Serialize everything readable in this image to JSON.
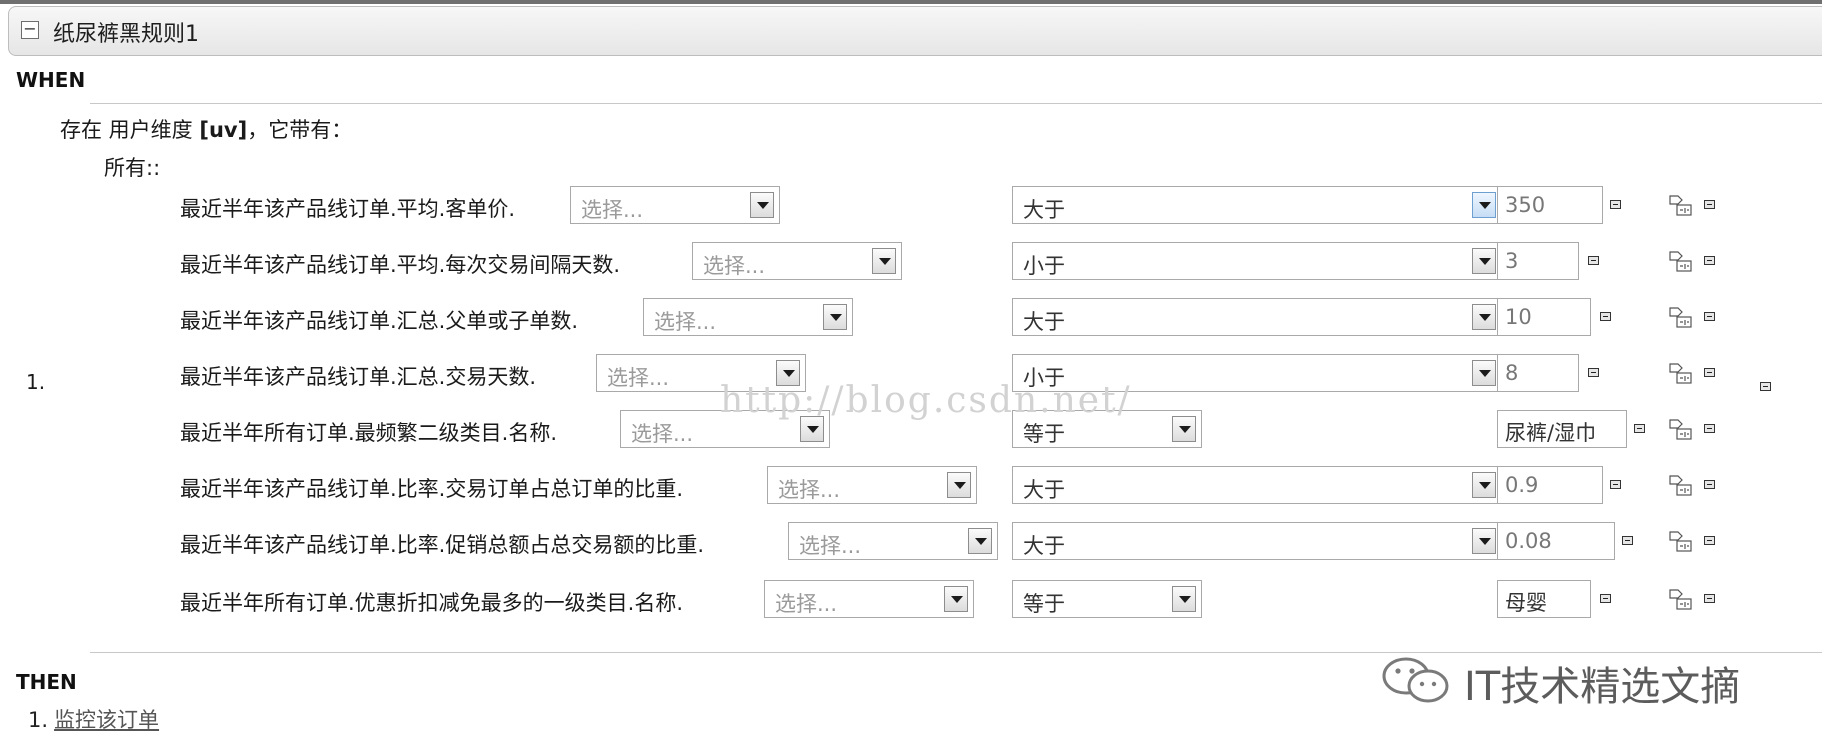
{
  "rule": {
    "collapse_symbol": "⊟",
    "title": "纸尿裤黑规则1"
  },
  "when_label": "WHEN",
  "then_label": "THEN",
  "fact": {
    "exists_prefix": "存在 用户维度 ",
    "binding": "[uv]",
    "exists_suffix": "，它带有：",
    "all_label": "所有::"
  },
  "row_number": "1.",
  "conditions": [
    {
      "field": "最近半年该产品线订单.平均.客单价.",
      "select_placeholder": "选择...",
      "operator": "大于",
      "value": "350"
    },
    {
      "field": "最近半年该产品线订单.平均.每次交易间隔天数.",
      "select_placeholder": "选择...",
      "operator": "小于",
      "value": "3"
    },
    {
      "field": "最近半年该产品线订单.汇总.父单或子单数.",
      "select_placeholder": "选择...",
      "operator": "大于",
      "value": "10"
    },
    {
      "field": "最近半年该产品线订单.汇总.交易天数.",
      "select_placeholder": "选择...",
      "operator": "小于",
      "value": "8"
    },
    {
      "field": "最近半年所有订单.最频繁二级类目.名称.",
      "select_placeholder": "选择...",
      "operator": "等于",
      "value": "尿裤/湿巾"
    },
    {
      "field": "最近半年该产品线订单.比率.交易订单占总订单的比重.",
      "select_placeholder": "选择...",
      "operator": "大于",
      "value": "0.9"
    },
    {
      "field": "最近半年该产品线订单.比率.促销总额占总交易额的比重.",
      "select_placeholder": "选择...",
      "operator": "大于",
      "value": "0.08"
    },
    {
      "field": "最近半年所有订单.优惠折扣减免最多的一级类目.名称.",
      "select_placeholder": "选择...",
      "operator": "等于",
      "value": "母婴"
    }
  ],
  "watermark": "http://blog.csdn.net/",
  "brand": {
    "text": "IT技术精选文摘",
    "icon": "wechat-icon"
  },
  "action": {
    "number": "1.",
    "label": "监控该订单"
  },
  "icons": {
    "remove": "minus-square-icon",
    "copy": "copy-row-icon"
  }
}
